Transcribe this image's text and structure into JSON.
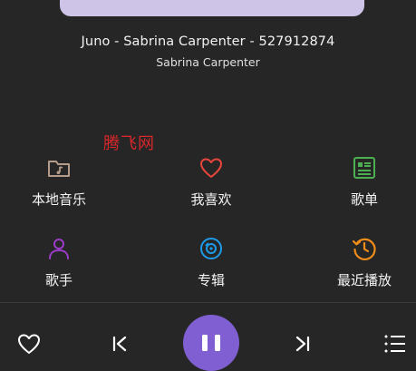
{
  "now_playing": {
    "title": "Juno - Sabrina Carpenter - 527912874",
    "artist": "Sabrina Carpenter"
  },
  "watermark": "腾飞网",
  "grid": {
    "items": [
      {
        "label": "本地音乐",
        "icon": "folder-music-icon",
        "color": "#b59b8a"
      },
      {
        "label": "我喜欢",
        "icon": "heart-icon",
        "color": "#e8453c"
      },
      {
        "label": "歌单",
        "icon": "playlist-icon",
        "color": "#4caf50"
      },
      {
        "label": "歌手",
        "icon": "person-icon",
        "color": "#9c3cc8"
      },
      {
        "label": "专辑",
        "icon": "disc-icon",
        "color": "#1e9be8"
      },
      {
        "label": "最近播放",
        "icon": "history-icon",
        "color": "#ef8c1a"
      }
    ]
  },
  "player_bar": {
    "favorite_icon": "heart-outline-icon",
    "previous_icon": "skip-previous-icon",
    "play_pause_icon": "pause-icon",
    "next_icon": "skip-next-icon",
    "queue_icon": "queue-list-icon",
    "accent": "#7f5fd1"
  }
}
